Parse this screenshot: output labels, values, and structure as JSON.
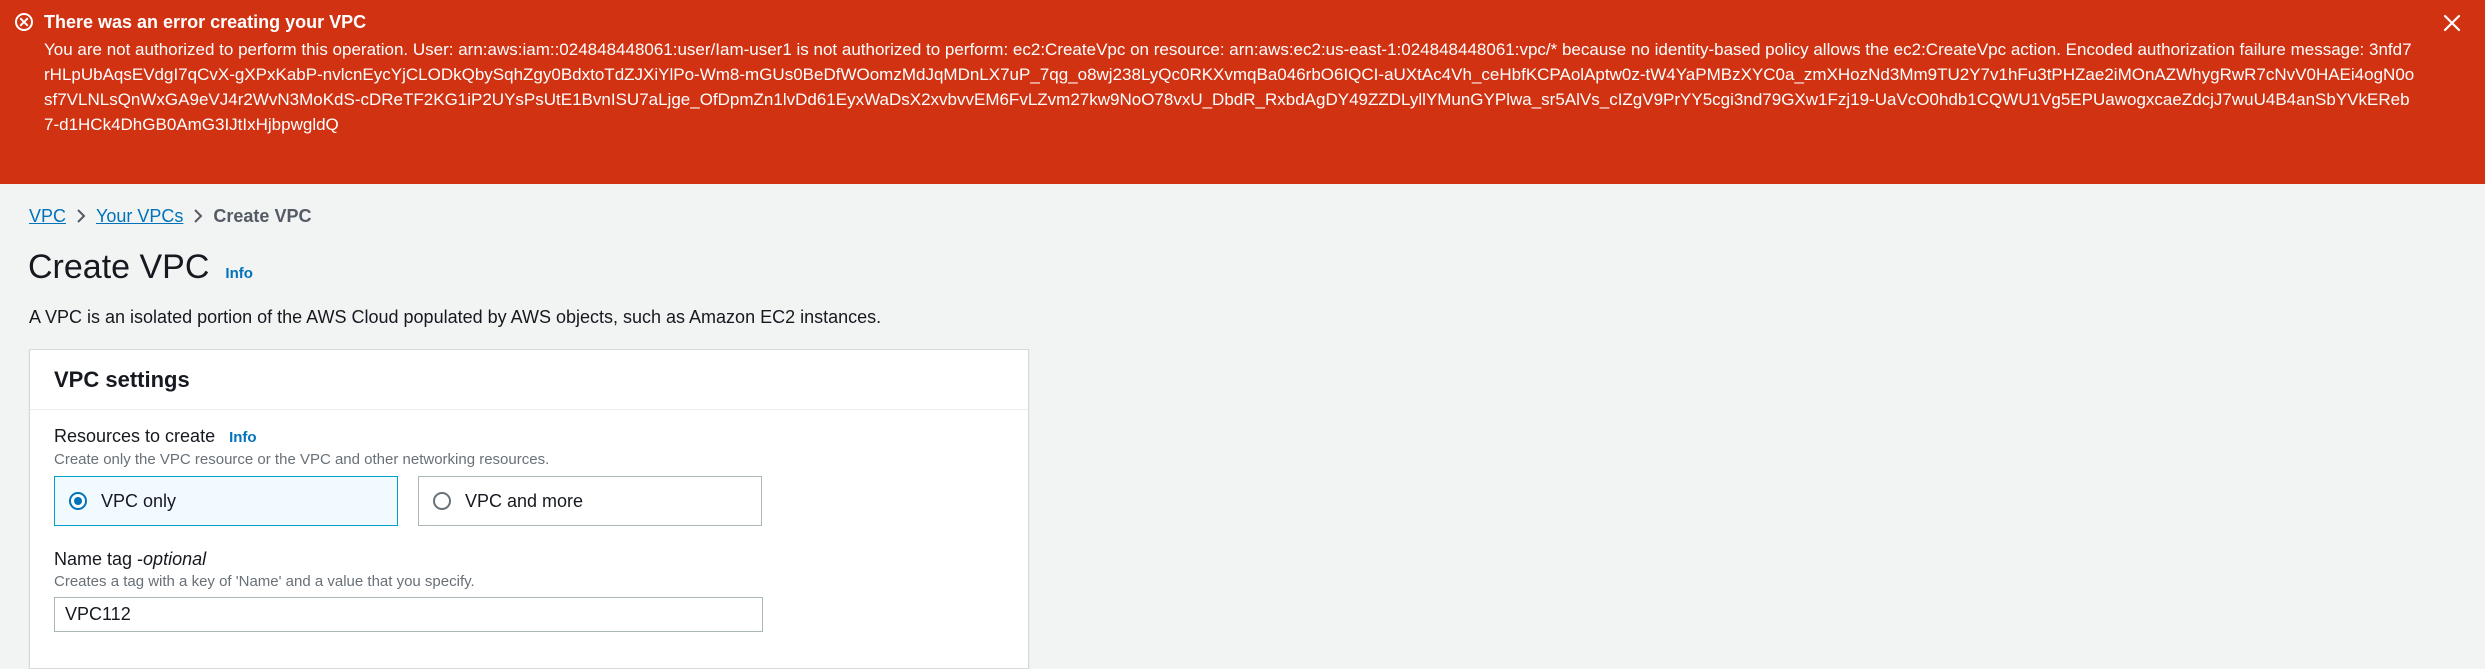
{
  "error_flash": {
    "title": "There was an error creating your VPC",
    "message": "You are not authorized to perform this operation. User: arn:aws:iam::024848448061:user/Iam-user1 is not authorized to perform: ec2:CreateVpc on resource: arn:aws:ec2:us-east-1:024848448061:vpc/* because no identity-based policy allows the ec2:CreateVpc action. Encoded authorization failure message: 3nfd7rHLpUbAqsEVdgI7qCvX-gXPxKabP-nvlcnEycYjCLODkQbySqhZgy0BdxtoTdZJXiYlPo-Wm8-mGUs0BeDfWOomzMdJqMDnLX7uP_7qg_o8wj238LyQc0RKXvmqBa046rbO6IQCI-aUXtAc4Vh_ceHbfKCPAolAptw0z-tW4YaPMBzXYC0a_zmXHozNd3Mm9TU2Y7v1hFu3tPHZae2iMOnAZWhygRwR7cNvV0HAEi4ogN0osf7VLNLsQnWxGA9eVJ4r2WvN3MoKdS-cDReTF2KG1iP2UYsPsUtE1BvnISU7aLjge_OfDpmZn1lvDd61EyxWaDsX2xvbvvEM6FvLZvm27kw9NoO78vxU_DbdR_RxbdAgDY49ZZDLyllYMunGYPlwa_sr5AlVs_cIZgV9PrYY5cgi3nd79GXw1Fzj19-UaVcO0hdb1CQWU1Vg5EPUawogxcaeZdcjJ7wuU4B4anSbYVkEReb7-d1HCk4DhGB0AmG3IJtIxHjbpwgldQ",
    "color": "#d13212"
  },
  "breadcrumb": {
    "items": [
      "VPC",
      "Your VPCs"
    ],
    "current": "Create VPC"
  },
  "header": {
    "title": "Create VPC",
    "info": "Info",
    "description": "A VPC is an isolated portion of the AWS Cloud populated by AWS objects, such as Amazon EC2 instances."
  },
  "vpc_settings": {
    "title": "VPC settings",
    "resources_label": "Resources to create",
    "resources_info": "Info",
    "resources_desc": "Create only the VPC resource or the VPC and other networking resources.",
    "options": [
      {
        "label": "VPC only",
        "selected": true
      },
      {
        "label": "VPC and more",
        "selected": false
      }
    ],
    "name_tag_label": "Name tag - ",
    "name_tag_optional": "optional",
    "name_tag_desc": "Creates a tag with a key of 'Name' and a value that you specify.",
    "name_tag_value": "VPC112"
  },
  "colors": {
    "link": "#0073bb",
    "error": "#d13212",
    "selected_bg": "#f1faff"
  }
}
